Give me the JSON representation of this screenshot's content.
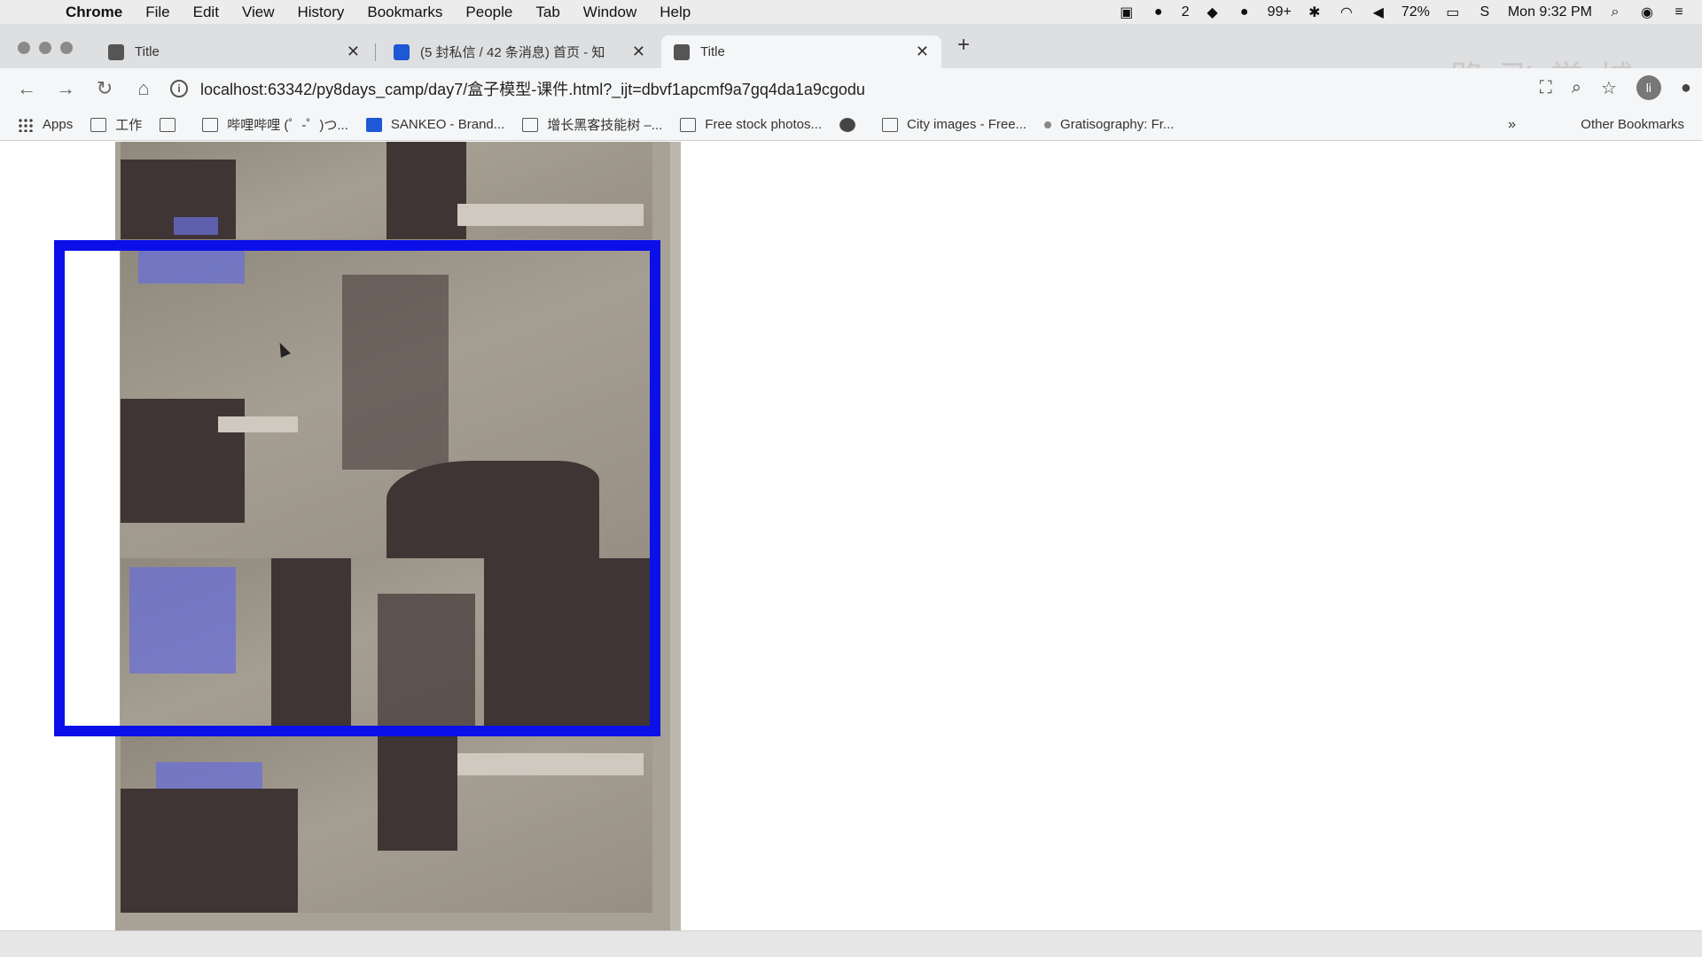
{
  "menubar": {
    "app": "Chrome",
    "items": [
      "File",
      "Edit",
      "View",
      "History",
      "Bookmarks",
      "People",
      "Tab",
      "Window",
      "Help"
    ],
    "status": {
      "badge_count": "2",
      "notifications": "99+",
      "battery": "72%",
      "clock": "Mon 9:32 PM"
    }
  },
  "tabs": [
    {
      "label": "Title"
    },
    {
      "label": "(5 封私信 / 42 条消息) 首页 - 知"
    },
    {
      "label": "Title"
    }
  ],
  "watermark": "路飞学城",
  "toolbar": {
    "url": "localhost:63342/py8days_camp/day7/盒子模型-课件.html?_ijt=dbvf1apcmf9a7gq4da1a9cgodu",
    "avatar_letter": "li"
  },
  "bookmarks": {
    "items": [
      {
        "label": "Apps",
        "icon": "apps-grid-icon"
      },
      {
        "label": "工作",
        "icon": "folder-icon"
      },
      {
        "label": "",
        "icon": "code-brackets-icon"
      },
      {
        "label": "哔哩哔哩 (゜-゜)つ...",
        "icon": "tv-icon"
      },
      {
        "label": "SANKEO - Brand...",
        "icon": "behance-icon"
      },
      {
        "label": "增长黑客技能树 –...",
        "icon": "box-icon"
      },
      {
        "label": "Free stock photos...",
        "icon": "pexels-icon"
      },
      {
        "label": "",
        "icon": "globe-icon"
      },
      {
        "label": "City images - Free...",
        "icon": "camera-icon"
      },
      {
        "label": "Gratisography: Fr...",
        "icon": "dot-icon"
      }
    ],
    "more": "»",
    "other": "Other Bookmarks"
  },
  "colors": {
    "box_border": "#0b10e8",
    "page_bg": "#ffffff"
  }
}
